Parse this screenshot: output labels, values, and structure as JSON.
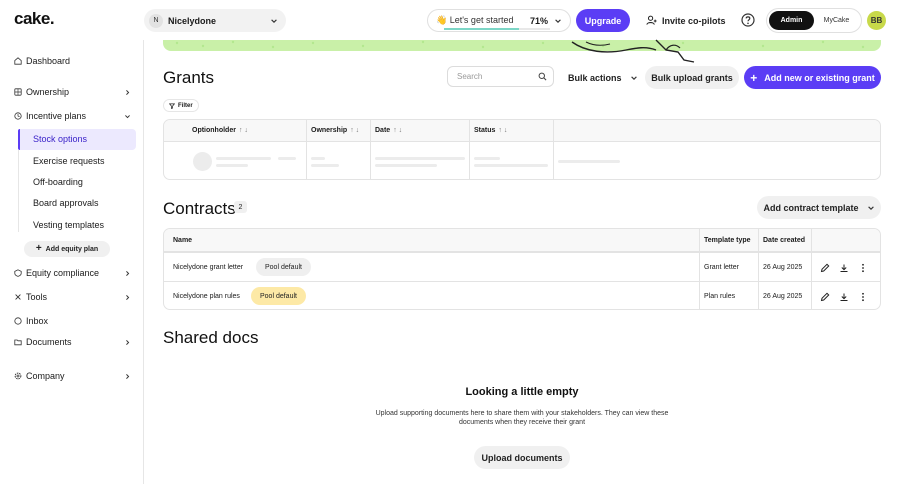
{
  "header": {
    "logo": "cake.",
    "company": {
      "initial": "N",
      "name": "Nicelydone"
    },
    "getting_started": {
      "label": "👋 Let's get started",
      "percent": "71%",
      "progress": 0.71
    },
    "upgrade_label": "Upgrade",
    "invite_label": "Invite co-pilots",
    "roles": [
      "Admin",
      "MyCake"
    ],
    "active_role": "Admin",
    "avatar_initials": "BB"
  },
  "sidebar": {
    "items": [
      {
        "label": "Dashboard"
      },
      {
        "label": "Ownership"
      },
      {
        "label": "Incentive plans"
      },
      {
        "label": "Equity compliance"
      },
      {
        "label": "Tools"
      },
      {
        "label": "Inbox"
      },
      {
        "label": "Documents"
      },
      {
        "label": "Company"
      }
    ],
    "sub_items": [
      {
        "label": "Stock options"
      },
      {
        "label": "Exercise requests"
      },
      {
        "label": "Off-boarding"
      },
      {
        "label": "Board approvals"
      },
      {
        "label": "Vesting templates"
      }
    ],
    "add_equity_label": "Add equity plan"
  },
  "grants": {
    "title": "Grants",
    "filter_label": "Filter",
    "search_placeholder": "Search",
    "bulk_actions_label": "Bulk actions",
    "bulk_upload_label": "Bulk upload grants",
    "add_grant_label": "Add new or existing grant",
    "columns": [
      "Optionholder",
      "Ownership",
      "Date",
      "Status"
    ]
  },
  "contracts": {
    "title": "Contracts",
    "count": "2",
    "add_template_label": "Add contract template",
    "columns": [
      "Name",
      "Template type",
      "Date created"
    ],
    "rows": [
      {
        "name": "Nicelydone grant letter",
        "badge": "Pool default",
        "template_type": "Grant letter",
        "date": "26 Aug 2025"
      },
      {
        "name": "Nicelydone plan rules",
        "badge": "Pool default",
        "template_type": "Plan rules",
        "date": "26 Aug 2025"
      }
    ]
  },
  "shared_docs": {
    "title": "Shared docs",
    "empty_title": "Looking a little empty",
    "empty_desc": "Upload supporting documents here to share them with your stakeholders. They can view these documents when they receive their grant",
    "upload_label": "Upload documents"
  },
  "colors": {
    "primary": "#5b3df5",
    "banner": "#c9f0a8",
    "badge_grey": "#efefef",
    "badge_yellow": "#fde9a6",
    "avatar": "#c8d94a"
  },
  "icons": [
    "home-icon",
    "pie-chart-icon",
    "gift-icon",
    "shield-icon",
    "wrench-icon",
    "inbox-icon",
    "folder-icon",
    "gear-icon",
    "search-icon",
    "help-icon",
    "add-person-icon",
    "edit-icon",
    "download-icon",
    "more-icon",
    "filter-icon",
    "plus-icon",
    "chevron-down-icon",
    "chevron-right-icon"
  ]
}
